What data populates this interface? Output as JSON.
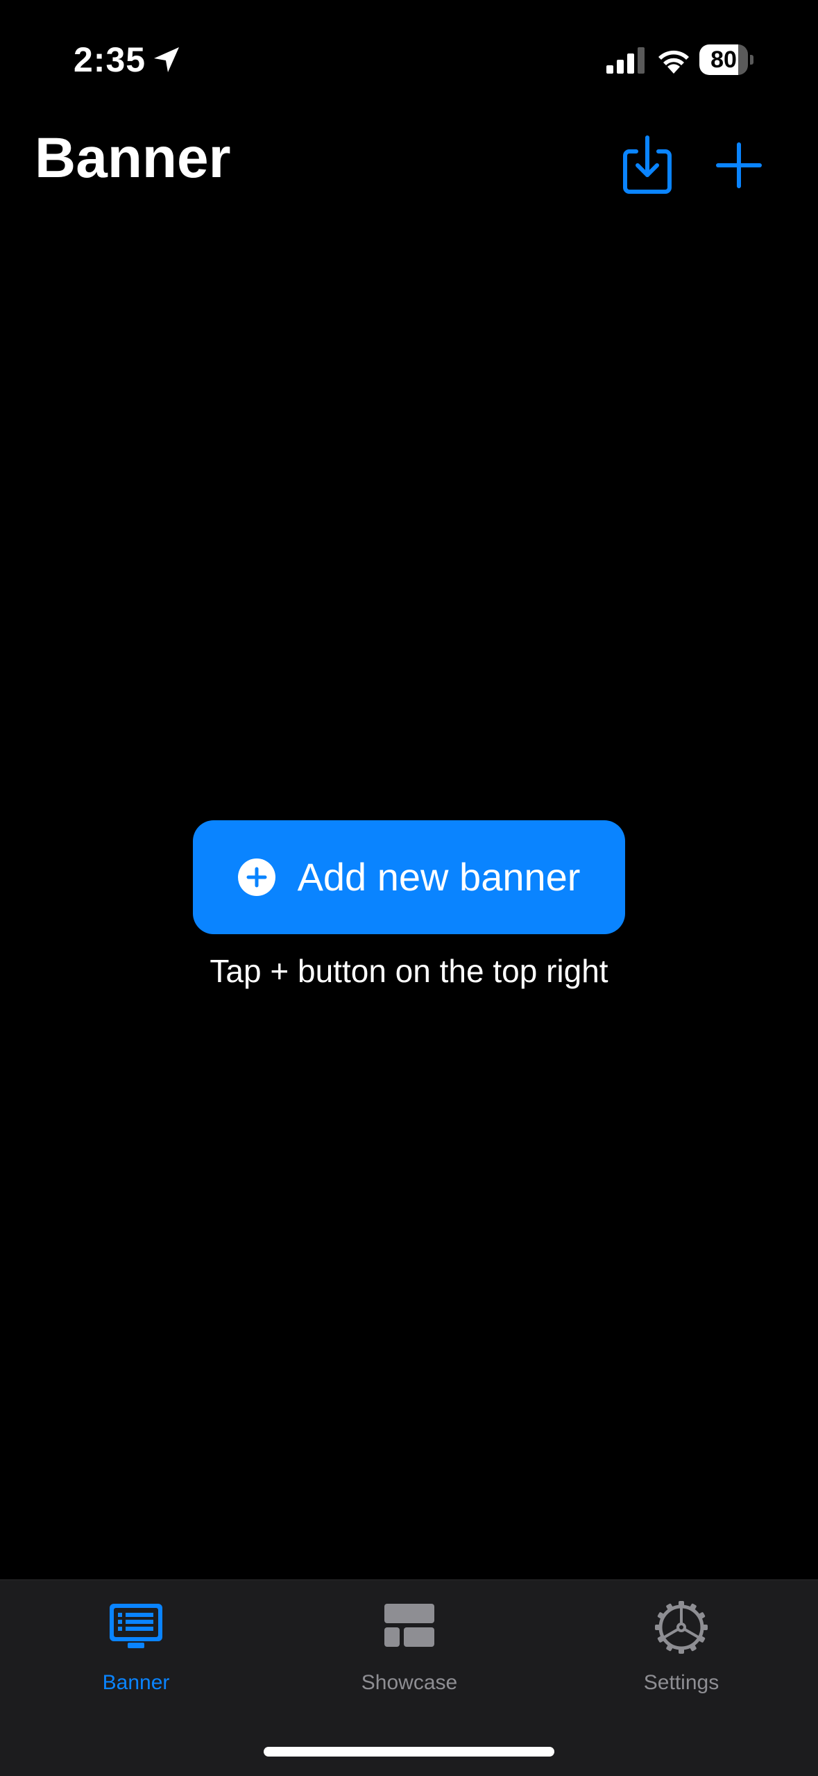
{
  "status_bar": {
    "time": "2:35",
    "battery_level": "80",
    "battery_fraction": 0.8
  },
  "nav": {
    "title": "Banner",
    "import_icon": "tray-arrow-down-icon",
    "add_icon": "plus-icon"
  },
  "empty_state": {
    "button_label": "Add new banner",
    "button_icon": "plus-circle-icon",
    "hint": "Tap + button on the top right"
  },
  "tabs": [
    {
      "label": "Banner",
      "icon": "display-list-icon",
      "selected": true
    },
    {
      "label": "Showcase",
      "icon": "layout-grid-icon",
      "selected": false
    },
    {
      "label": "Settings",
      "icon": "gear-icon",
      "selected": false
    }
  ],
  "colors": {
    "accent": "#0a84ff",
    "background": "#000000",
    "tab_bar_background": "#1c1c1e",
    "tab_inactive": "#8e8e93",
    "text_primary": "#ffffff"
  }
}
